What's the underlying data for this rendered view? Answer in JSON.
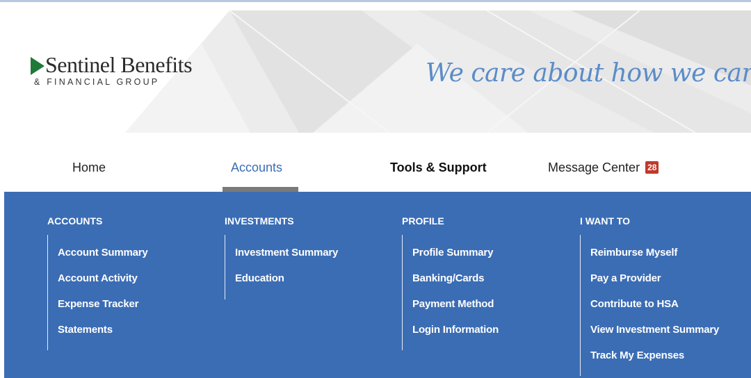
{
  "brand": {
    "name": "Sentinel Benefits",
    "subname": "& FINANCIAL GROUP",
    "tagline": "We care about how we can help.",
    "accent": "#1f7a3a"
  },
  "nav": {
    "items": [
      {
        "label": "Home"
      },
      {
        "label": "Accounts",
        "active": true
      },
      {
        "label": "Tools & Support"
      },
      {
        "label": "Message Center",
        "badge": "28"
      }
    ]
  },
  "menu": {
    "background": "#3b6db5",
    "columns": [
      {
        "title": "ACCOUNTS",
        "links": [
          "Account Summary",
          "Account Activity",
          "Expense Tracker",
          "Statements"
        ]
      },
      {
        "title": "INVESTMENTS",
        "links": [
          "Investment Summary",
          "Education"
        ]
      },
      {
        "title": "PROFILE",
        "links": [
          "Profile Summary",
          "Banking/Cards",
          "Payment Method",
          "Login Information"
        ]
      },
      {
        "title": "I WANT TO",
        "links": [
          "Reimburse Myself",
          "Pay a Provider",
          "Contribute to HSA",
          "View Investment Summary",
          "Track My Expenses"
        ]
      }
    ]
  }
}
